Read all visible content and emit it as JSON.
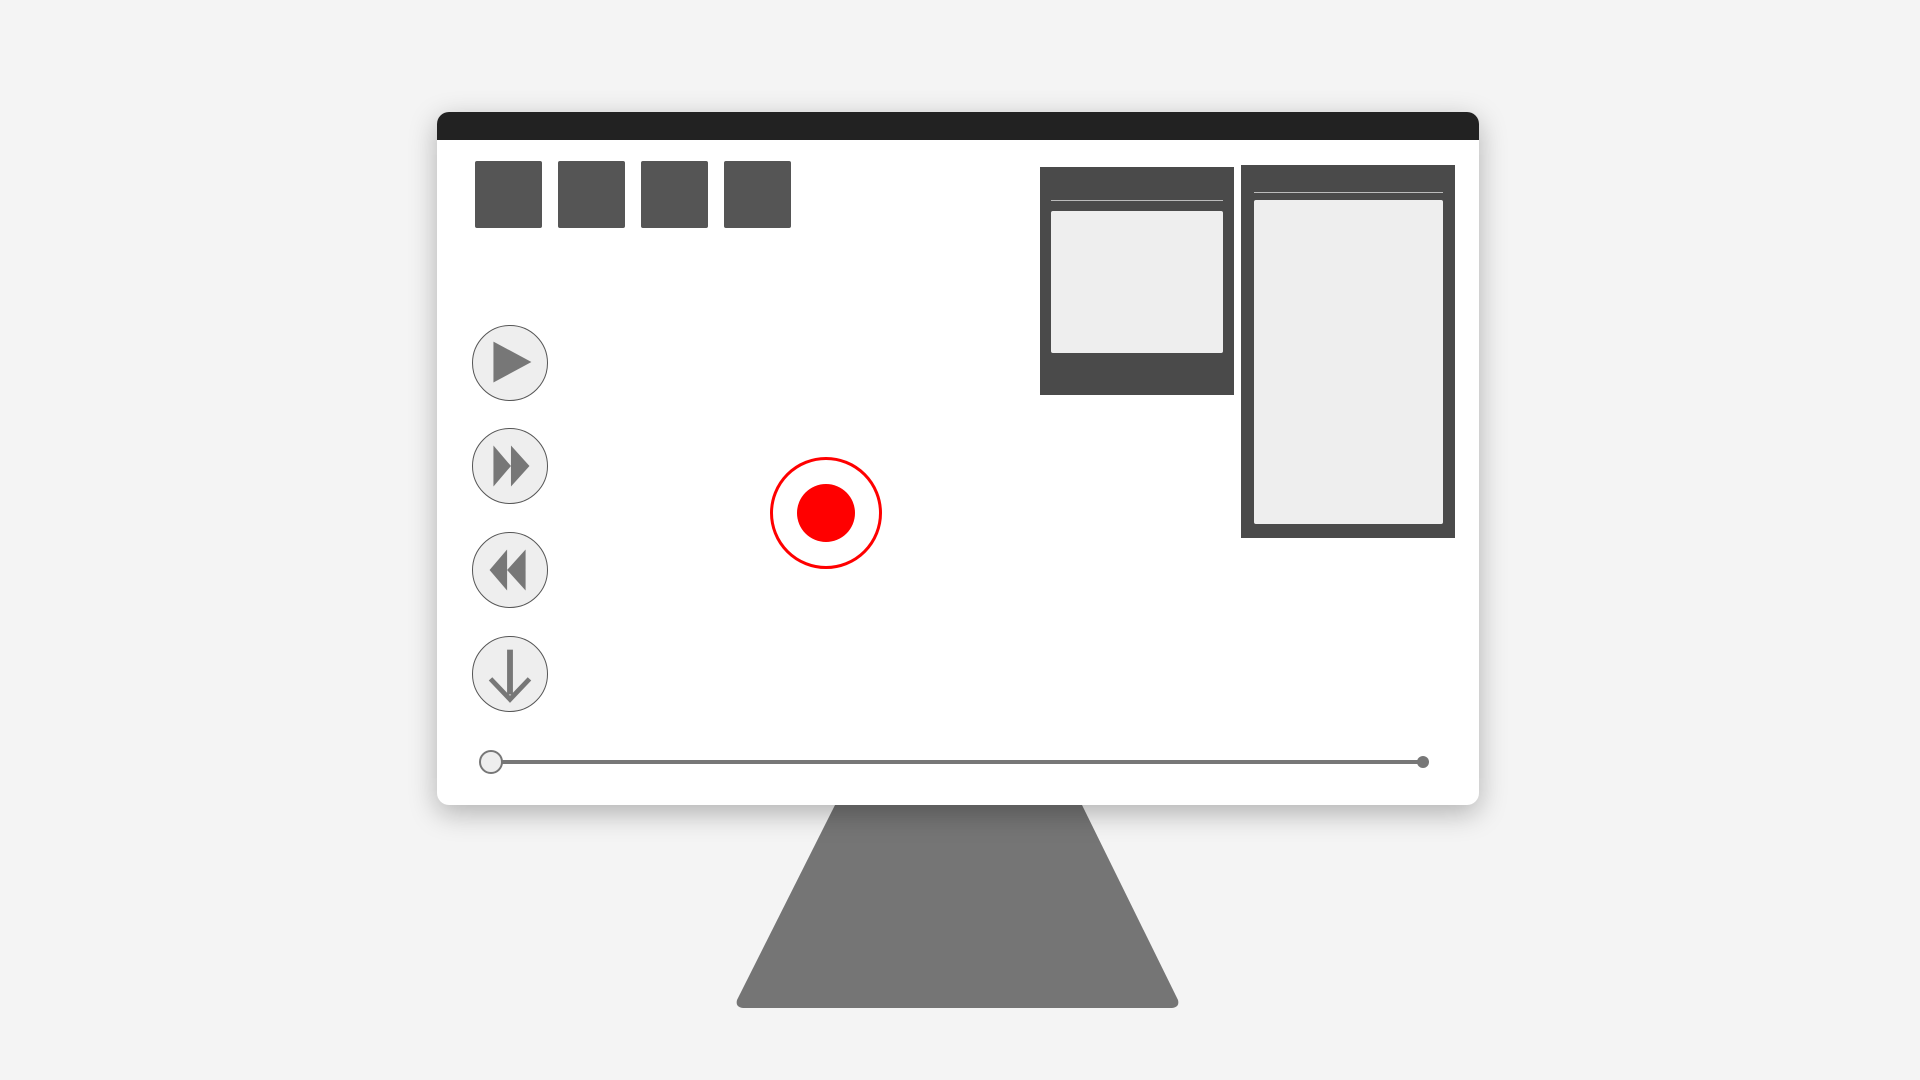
{
  "colors": {
    "background": "#f4f4f4",
    "screen": "#ffffff",
    "titlebar": "#222222",
    "toolbar_button": "#555555",
    "panel": "#4a4a4a",
    "panel_content": "#eeeeee",
    "control_icon": "#777777",
    "record": "#ff0000",
    "stand": "#757575"
  },
  "toolbar": {
    "buttons": [
      {
        "icon": "square-button"
      },
      {
        "icon": "square-button"
      },
      {
        "icon": "square-button"
      },
      {
        "icon": "square-button"
      }
    ]
  },
  "controls": [
    {
      "icon": "play-icon"
    },
    {
      "icon": "fast-forward-icon"
    },
    {
      "icon": "rewind-icon"
    },
    {
      "icon": "download-icon"
    }
  ],
  "record": {
    "icon": "record-icon"
  },
  "progress": {
    "value": 0
  }
}
